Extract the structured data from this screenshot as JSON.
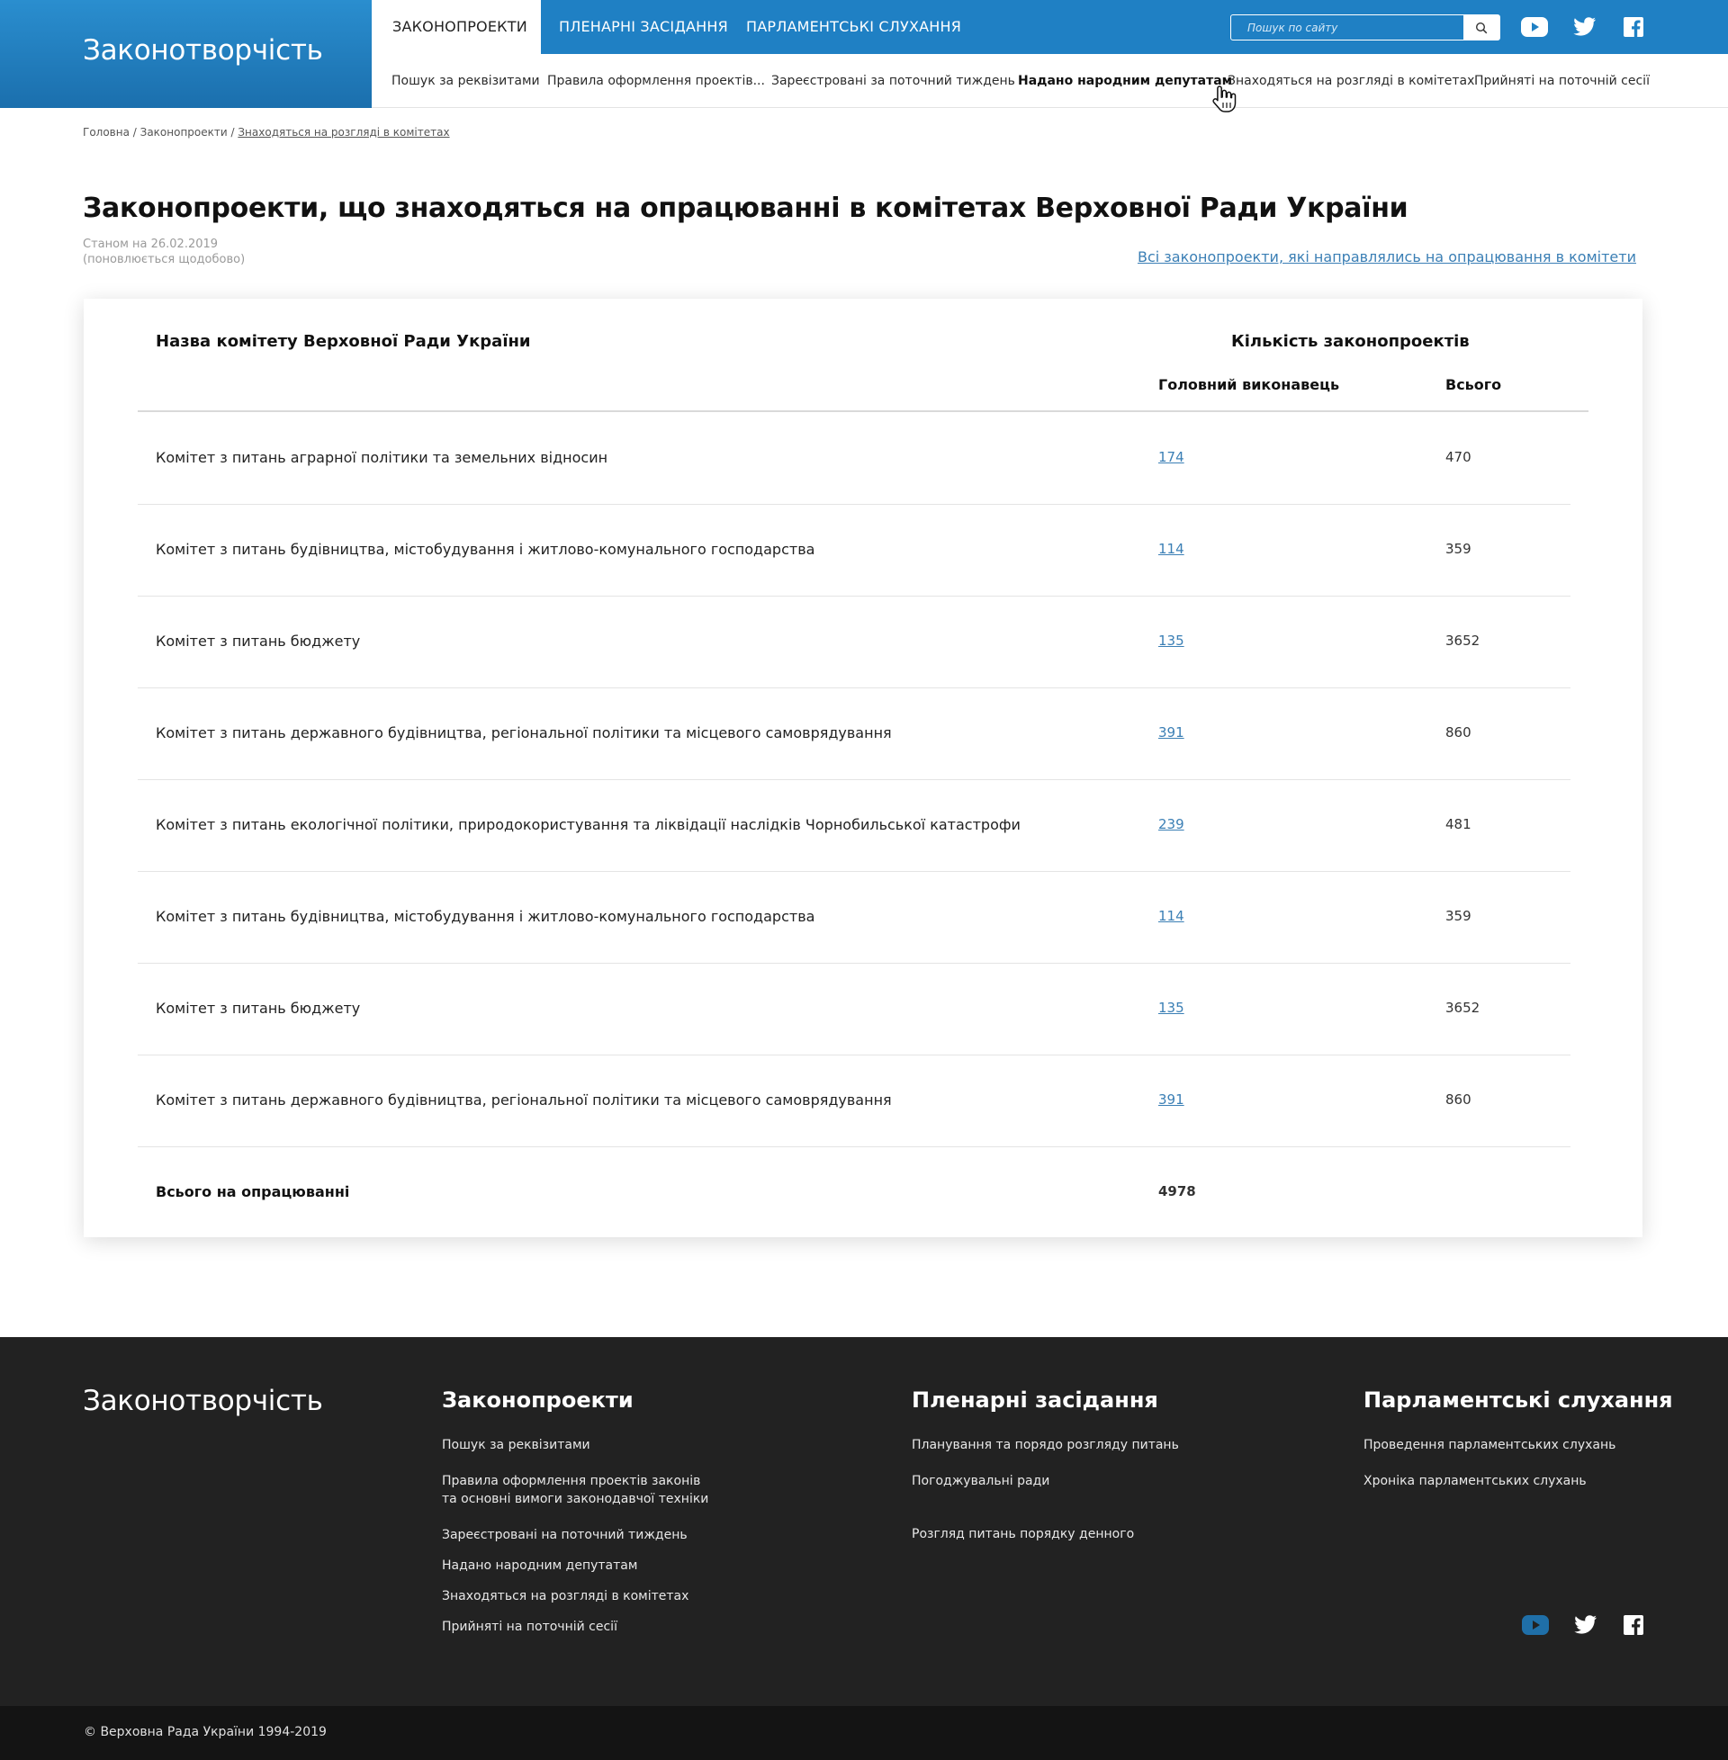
{
  "header": {
    "brand": "Законотворчість",
    "tabs": [
      {
        "label": "ЗАКОНОПРОЕКТИ",
        "active": true
      },
      {
        "label": "ПЛЕНАРНІ ЗАСІДАННЯ",
        "active": false
      },
      {
        "label": "ПАРЛАМЕНТСЬКІ СЛУХАННЯ",
        "active": false
      }
    ],
    "search": {
      "placeholder": "Пошук по сайту",
      "value": ""
    },
    "social_icons": [
      "youtube-icon",
      "twitter-icon",
      "facebook-icon"
    ]
  },
  "subnav": [
    {
      "label": "Пошук за реквізитами"
    },
    {
      "label": "Правила оформлення проектів..."
    },
    {
      "label": "Зареєстровані за поточний тиждень"
    },
    {
      "label": "Надано народним депутатам"
    },
    {
      "label": "Знаходяться на розгляді в комітетах"
    },
    {
      "label": "Прийняті на поточній сесії"
    }
  ],
  "breadcrumb": {
    "home": "Головна",
    "section": "Законопроекти",
    "current": "Знаходяться на розгляді в комітетах",
    "separator": " / "
  },
  "page": {
    "title": "Законопроекти, що знаходяться на опрацюванні в комітетах Верховної Ради України",
    "status_date": "Станом на 26.02.2019",
    "status_note": "(поновлюється щодобово)",
    "all_link": "Всі законопроекти, які направлялись на опрацювання в комітети"
  },
  "table": {
    "header_name": "Назва комітету Верховної Ради України",
    "header_count": "Кількість законопроектів",
    "header_main": "Головний виконавець",
    "header_total": "Всього",
    "rows": [
      {
        "name": "Комітет з питань аграрної політики та земельних відносин",
        "main": "174",
        "total": "470"
      },
      {
        "name": "Комітет з питань будівництва, містобудування і житлово-комунального господарства",
        "main": "114",
        "total": "359"
      },
      {
        "name": "Комітет з питань бюджету",
        "main": "135",
        "total": "3652"
      },
      {
        "name": "Комітет з питань державного будівництва, регіональної політики та місцевого самоврядування",
        "main": "391",
        "total": "860"
      },
      {
        "name": "Комітет з питань екологічної політики, природокористування та ліквідації наслідків Чорнобильської катастрофи",
        "main": "239",
        "total": "481"
      },
      {
        "name": "Комітет з питань будівництва, містобудування і житлово-комунального господарства",
        "main": "114",
        "total": "359"
      },
      {
        "name": "Комітет з питань бюджету",
        "main": "135",
        "total": "3652"
      },
      {
        "name": "Комітет з питань державного будівництва, регіональної політики та місцевого самоврядування",
        "main": "391",
        "total": "860"
      }
    ],
    "summary": {
      "name": "Всього на опрацюванні",
      "main": "4978"
    }
  },
  "footer": {
    "brand": "Законотворчість",
    "columns": [
      {
        "title": "Законопроекти",
        "links": [
          "Пошук за реквізитами",
          "Правила оформлення проектів законів",
          "та основні вимоги законодавчої техніки",
          "Зареєстровані на поточний тиждень",
          "Надано народним депутатам",
          "Знаходяться на розгляді в комітетах",
          "Прийняті на поточній сесії"
        ]
      },
      {
        "title": "Пленарні засідання",
        "links": [
          "Планування та порядо розгляду питань",
          "Погоджувальні ради",
          "Розгляд питань порядку денного"
        ]
      },
      {
        "title": "Парламентські слухання",
        "links": [
          "Проведення парламентських слухань",
          "Хроніка парламентських слухань"
        ]
      }
    ],
    "social_icons": [
      "youtube-icon",
      "twitter-icon",
      "facebook-icon"
    ],
    "copyright": "© Верховна Рада України 1994-2019"
  },
  "colors": {
    "primary_blue": "#1f80c4",
    "link_blue": "#3b7fb5",
    "footer_dark": "#222222",
    "bottom_bar": "#141414",
    "footer_youtube": "#1f6fa8"
  }
}
